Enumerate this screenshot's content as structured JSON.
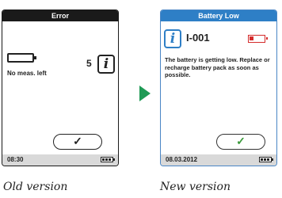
{
  "old_screen": {
    "title": "Error",
    "count": "5",
    "message": "No meas. left",
    "ok_symbol": "✓",
    "footer_time": "08:30"
  },
  "new_screen": {
    "title": "Battery Low",
    "code": "I-001",
    "message": "The battery is getting low. Replace or recharge battery pack as soon as possible.",
    "ok_symbol": "✓",
    "footer_date": "08.03.2012"
  },
  "info_symbol": "i",
  "captions": {
    "old": "Old version",
    "new": "New version"
  },
  "colors": {
    "old_title_bar": "#1a1a1a",
    "new_title_bar": "#2e7fc6",
    "arrow": "#1f9a55",
    "low_battery": "#d42b2b",
    "ok_check": "#3a9a3a"
  },
  "icons": [
    "empty-battery-icon",
    "info-icon",
    "low-battery-icon",
    "checkmark-icon",
    "battery-status-icon",
    "right-arrow-icon"
  ]
}
